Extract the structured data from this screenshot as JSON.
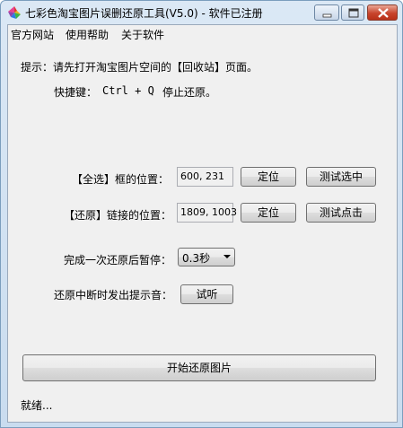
{
  "window": {
    "title": "七彩色淘宝图片误删还原工具(V5.0) - 软件已注册"
  },
  "menu": {
    "items": [
      "官方网站",
      "使用帮助",
      "关于软件"
    ]
  },
  "tips": {
    "hint": "提示：请先打开淘宝图片空间的【回收站】页面。",
    "shortcut_label": "快捷键：",
    "shortcut_key": "Ctrl + Q",
    "shortcut_action": "停止还原。"
  },
  "select_all": {
    "label": "【全选】框的位置：",
    "value": "600, 231",
    "locate_label": "定位",
    "test_label": "测试选中"
  },
  "restore_link": {
    "label": "【还原】链接的位置：",
    "value": "1809, 1003",
    "locate_label": "定位",
    "test_label": "测试点击"
  },
  "pause": {
    "label": "完成一次还原后暂停：",
    "selected": "0.3秒"
  },
  "sound": {
    "label": "还原中断时发出提示音：",
    "button_label": "试听"
  },
  "start_button": "开始还原图片",
  "status": "就绪..."
}
